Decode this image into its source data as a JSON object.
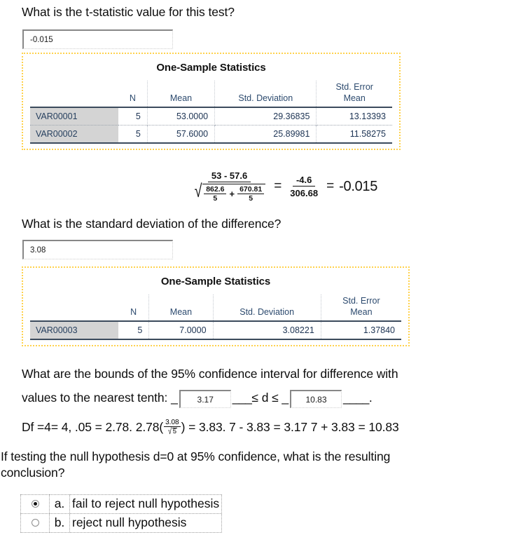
{
  "questions": {
    "q1": {
      "prompt": "What is the t-statistic value for this test?",
      "answer_value": "-0.015"
    },
    "q2": {
      "prompt": "What is the standard deviation of the difference?",
      "answer_value": "3.08"
    },
    "q3": {
      "prompt_line1": "What are the bounds of the 95% confidence interval for difference with",
      "prompt_line2_pre": "values to the nearest tenth: _",
      "lower_value": "3.17",
      "middle_text": "≤ d ≤ _",
      "upper_value": "10.83",
      "blank_after_lower": "___",
      "blank_after_upper": "____",
      "trailing_period": "."
    },
    "q4": {
      "prompt_line1": "If testing the null hypothesis d=0 at 95% confidence, what is the resulting",
      "prompt_line2": "conclusion?",
      "options": [
        {
          "letter": "a.",
          "label": "fail to reject null hypothesis",
          "selected": true
        },
        {
          "letter": "b.",
          "label": "reject null hypothesis",
          "selected": false
        }
      ]
    }
  },
  "table1": {
    "title": "One-Sample Statistics",
    "columns": [
      "",
      "N",
      "Mean",
      "Std. Deviation",
      "Std. Error\nMean"
    ],
    "rows": [
      {
        "label": "VAR00001",
        "n": "5",
        "mean": "53.0000",
        "sd": "29.36835",
        "se": "13.13393"
      },
      {
        "label": "VAR00002",
        "n": "5",
        "mean": "57.6000",
        "sd": "25.89981",
        "se": "11.58275"
      }
    ]
  },
  "table2": {
    "title": "One-Sample Statistics",
    "columns": [
      "",
      "N",
      "Mean",
      "Std. Deviation",
      "Std. Error\nMean"
    ],
    "rows": [
      {
        "label": "VAR00003",
        "n": "5",
        "mean": "7.0000",
        "sd": "3.08221",
        "se": "1.37840"
      }
    ]
  },
  "formula_t": {
    "numerator": "53 - 57.6",
    "den_term1_num": "862.6",
    "den_term1_den": "5",
    "den_plus": "+",
    "den_term2_num": "670.81",
    "den_term2_den": "5",
    "equals1": "=",
    "frac2_num": "-4.6",
    "frac2_den": "306.68",
    "equals2": "=",
    "result": "-0.015"
  },
  "formula_df": {
    "part1": "Df =4= 4, .05 = 2.78.  2.78(",
    "sqrt_num": "3.08",
    "sqrt_radicand": "5",
    "part2": ") = 3.83.  7 - 3.83 = 3.17 7 + 3.83 = 10.83"
  },
  "colors": {
    "spss_frame": "#ffd24d",
    "spss_header_text": "#2c4a6e",
    "spss_rowlabel_bg": "#d4d4d4",
    "text": "#0d0d0d"
  }
}
